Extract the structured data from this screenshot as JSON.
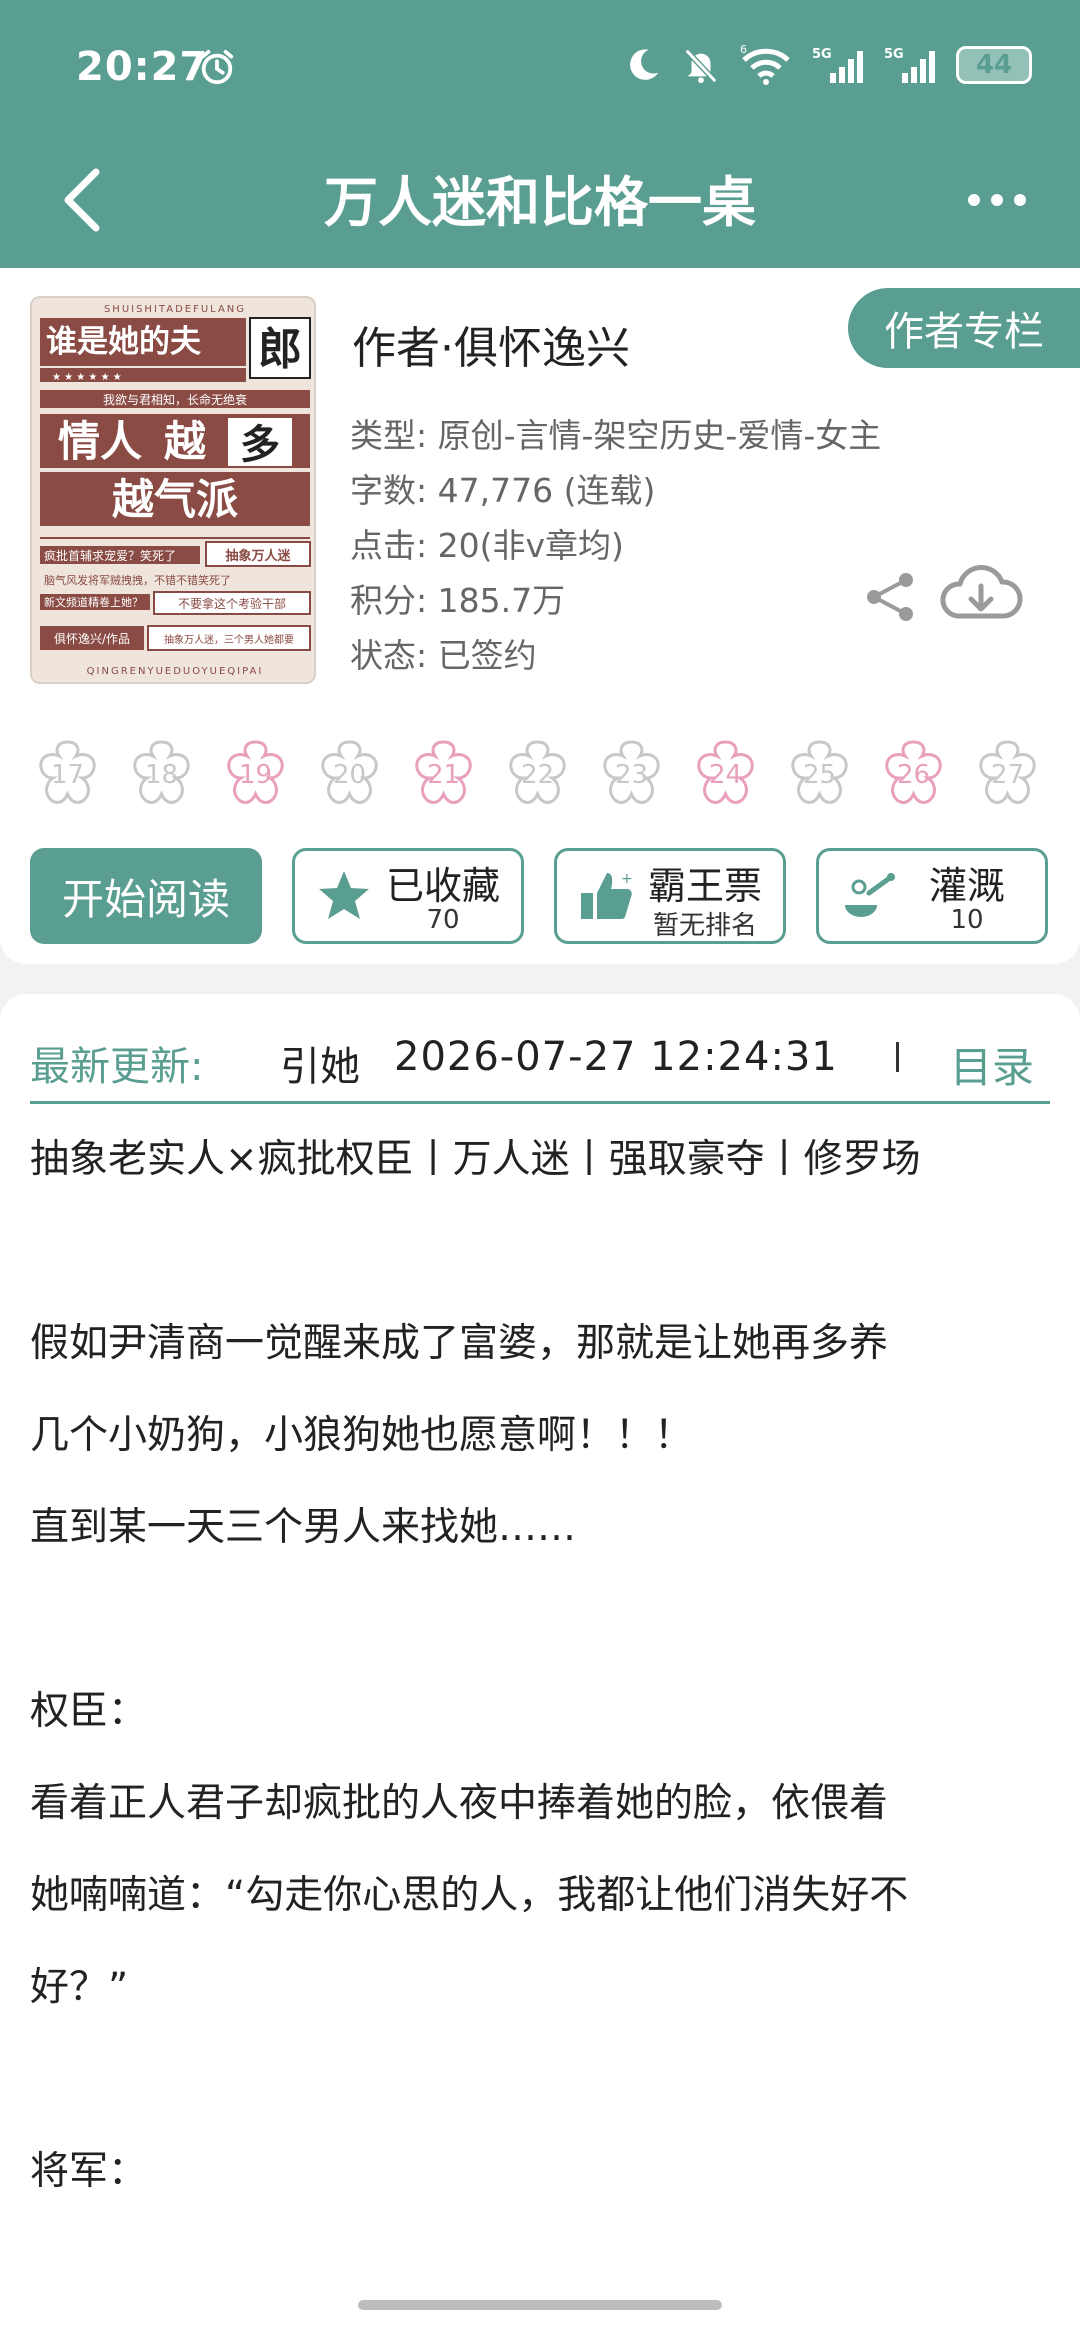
{
  "status_bar": {
    "time": "20:27",
    "battery": "44",
    "signal_1": "5G",
    "signal_2": "5G",
    "wifi_badge": "6"
  },
  "nav": {
    "title": "万人迷和比格一桌"
  },
  "book": {
    "cover_text": {
      "top_pinyin": "SHUISHITADEFULANG",
      "title_top": "谁是她的夫",
      "title_char": "郎",
      "slogan": "我欲与君相知，长命无绝衰",
      "main_1a": "情人",
      "main_1b": "越",
      "main_1c": "多",
      "main_2": "越气派",
      "blurb_1": "疯批首辅求宠爱？笑死了",
      "tag_1": "抽象万人迷",
      "blurb_2": "脑气风发将军贼拽拽，不错不错笑死了",
      "blurb_3": "新文频道精卷上她？",
      "tag_2": "不要拿这个考验干部",
      "author_line": "俱怀逸兴/作品",
      "tag_3": "抽象万人迷，三个男人她都要",
      "bottom_pinyin": "QINGRENYUEDUOYUEQIPAI"
    },
    "author": "作者·俱怀逸兴",
    "author_column": "作者专栏",
    "type": "类型: 原创-言情-架空历史-爱情-女主",
    "words": "字数: 47,776 (连载)",
    "clicks": "点击: 20(非v章均)",
    "score": "积分: 185.7万",
    "state": "状态: 已签约"
  },
  "calendar": [
    {
      "day": "17",
      "active": false
    },
    {
      "day": "18",
      "active": false
    },
    {
      "day": "19",
      "active": true
    },
    {
      "day": "20",
      "active": false
    },
    {
      "day": "21",
      "active": true
    },
    {
      "day": "22",
      "active": false
    },
    {
      "day": "23",
      "active": false
    },
    {
      "day": "24",
      "active": true
    },
    {
      "day": "25",
      "active": false
    },
    {
      "day": "26",
      "active": true
    },
    {
      "day": "27",
      "active": false
    }
  ],
  "actions": {
    "read": "开始阅读",
    "favorite_label": "已收藏",
    "favorite_count": "70",
    "ticket_label": "霸王票",
    "ticket_sub": "暂无排名",
    "water_label": "灌溉",
    "water_count": "10"
  },
  "latest": {
    "label": "最新更新:",
    "chapter": "引她",
    "time": "2026-07-27 12:24:31",
    "toc": "目录"
  },
  "description": [
    "抽象老实人×疯批权臣丨万人迷丨强取豪夺丨修罗场",
    "",
    "假如尹清商一觉醒来成了富婆，那就是让她再多养",
    "几个小奶狗，小狼狗她也愿意啊！！！",
    "直到某一天三个男人来找她……",
    "",
    "权臣：",
    "看着正人君子却疯批的人夜中捧着她的脸，依偎着",
    "她喃喃道：“勾走你心思的人，我都让他们消失好不",
    "好？”",
    "",
    "将军："
  ],
  "colors": {
    "accent": "#5a9e91",
    "flower_active": "#e8a0bd",
    "flower_inactive": "#c8c8c8",
    "cover_brown": "#8a4b44"
  }
}
